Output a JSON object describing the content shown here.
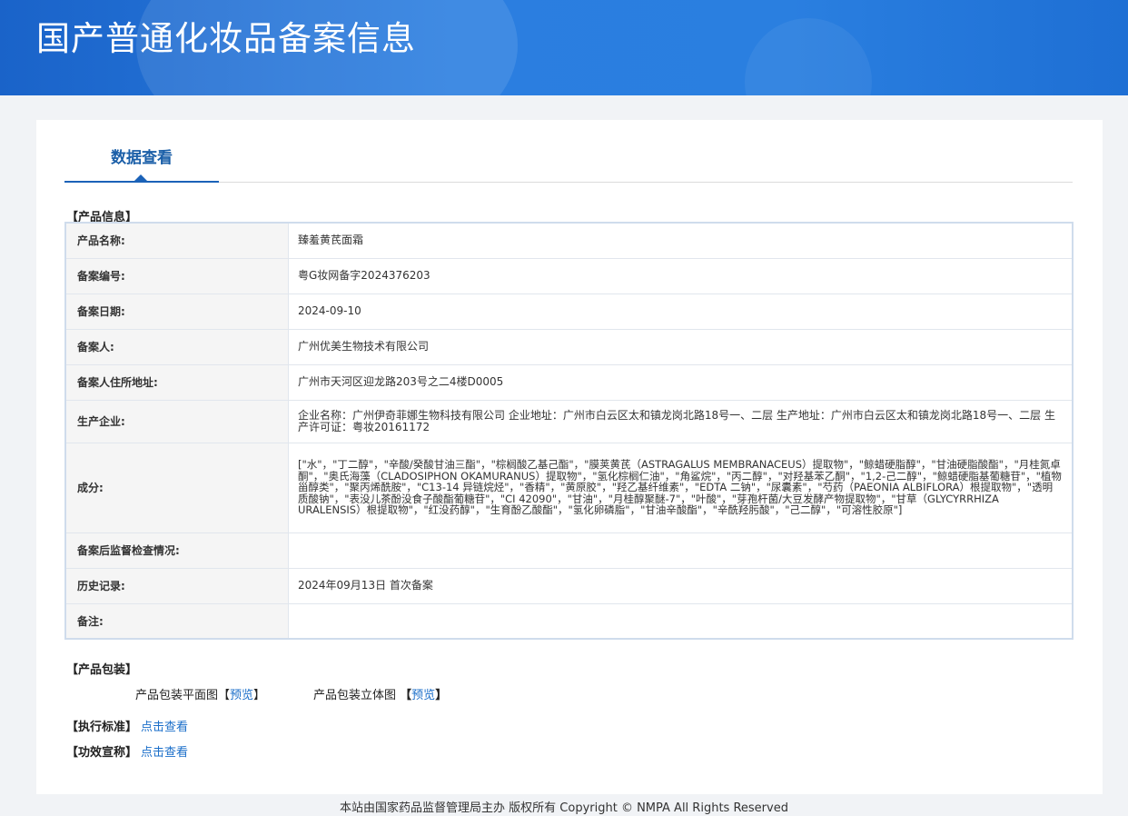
{
  "header": {
    "title": "国产普通化妆品备案信息"
  },
  "tab": {
    "label": "数据查看"
  },
  "product_section": {
    "title": "【产品信息】"
  },
  "rows": [
    {
      "label": "产品名称:",
      "value": "臻羞黄芪面霜"
    },
    {
      "label": "备案编号:",
      "value": "粤G妆网备字2024376203"
    },
    {
      "label": "备案日期:",
      "value": "2024-09-10"
    },
    {
      "label": "备案人:",
      "value": "广州优美生物技术有限公司"
    },
    {
      "label": "备案人住所地址:",
      "value": "广州市天河区迎龙路203号之二4楼D0005"
    },
    {
      "label": "生产企业:",
      "value": "企业名称：广州伊奇菲娜生物科技有限公司 企业地址：广州市白云区太和镇龙岗北路18号一、二层 生产地址：广州市白云区太和镇龙岗北路18号一、二层 生产许可证：粤妆20161172"
    },
    {
      "label": "成分:",
      "value": "[\"水\"，\"丁二醇\"，\"辛酸/癸酸甘油三酯\"，\"棕榈酸乙基己酯\"，\"膜荚黄芪（ASTRAGALUS MEMBRANACEUS）提取物\"，\"鲸蜡硬脂醇\"，\"甘油硬脂酸酯\"，\"月桂氮卓酮\"，\"奥氏海藻（CLADOSIPHON OKAMURANUS）提取物\"，\"氢化棕榈仁油\"，\"角鲨烷\"，\"丙二醇\"，\"对羟基苯乙酮\"，\"1,2-己二醇\"，\"鲸蜡硬脂基葡糖苷\"，\"植物甾醇类\"，\"聚丙烯酰胺\"，\"C13-14 异链烷烃\"，\"香精\"，\"黄原胶\"，\"羟乙基纤维素\"，\"EDTA 二钠\"，\"尿囊素\"，\"芍药（PAEONIA ALBIFLORA）根提取物\"，\"透明质酸钠\"，\"表没儿茶酚没食子酸酯葡糖苷\"，\"CI 42090\"，\"甘油\"，\"月桂醇聚醚-7\"，\"叶酸\"，\"芽孢杆菌/大豆发酵产物提取物\"，\"甘草（GLYCYRRHIZA URALENSIS）根提取物\"，\"红没药醇\"，\"生育酚乙酸酯\"，\"氢化卵磷脂\"，\"甘油辛酸酯\"，\"辛酰羟肟酸\"，\"己二醇\"，\"可溶性胶原\"]"
    },
    {
      "label": "备案后监督检查情况:",
      "value": ""
    },
    {
      "label": "历史记录:",
      "value": "2024年09月13日 首次备案"
    },
    {
      "label": "备注:",
      "value": ""
    }
  ],
  "packaging": {
    "title": "【产品包装】",
    "flat_label": "产品包装平面图",
    "solid_label": "产品包装立体图",
    "bracket_open": "【",
    "bracket_close": "】",
    "preview": "预览"
  },
  "standard": {
    "title": "【执行标准】",
    "link": "点击查看"
  },
  "efficacy": {
    "title": "【功效宣称】",
    "link": "点击查看"
  },
  "footer": {
    "text": "本站由国家药品监督管理局主办 版权所有 Copyright © NMPA All Rights Reserved"
  },
  "colors": {
    "banner": "#2b7ee0",
    "tab_accent": "#1b62b8",
    "link": "#1a6ec9"
  }
}
